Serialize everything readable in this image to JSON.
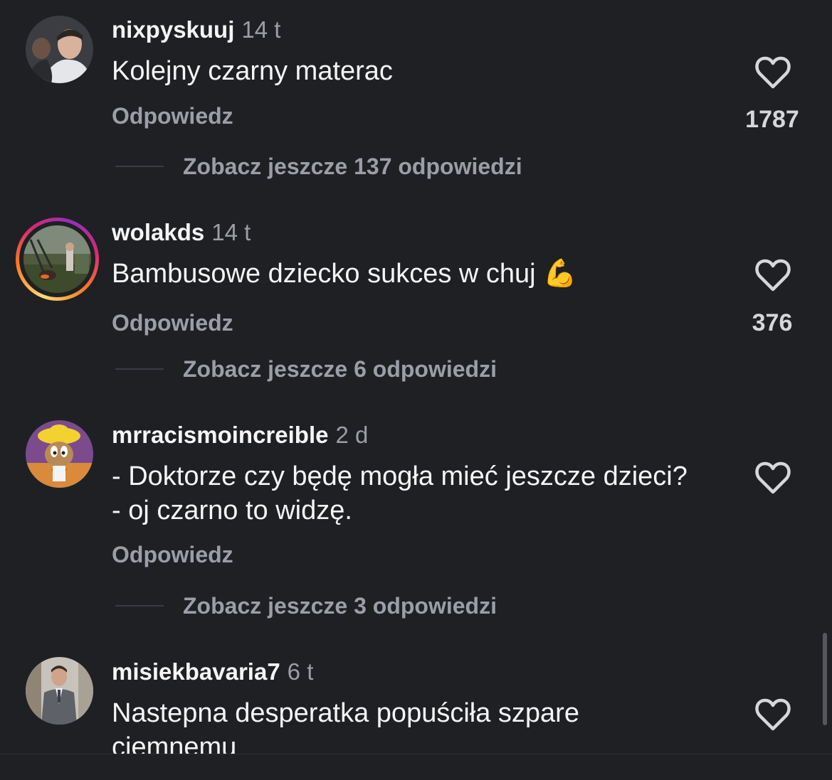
{
  "comments": [
    {
      "username": "nixpyskuuj",
      "time": "14 t",
      "text": "Kolejny czarny materac",
      "reply_label": "Odpowiedz",
      "likes": "1787",
      "more_replies": "Zobacz jeszcze 137 odpowiedzi"
    },
    {
      "username": "wolakds",
      "time": "14 t",
      "text": "Bambusowe dziecko sukces w chuj",
      "emoji": "💪",
      "reply_label": "Odpowiedz",
      "likes": "376",
      "more_replies": "Zobacz jeszcze 6 odpowiedzi"
    },
    {
      "username": "mrracismoincreible",
      "time": "2 d",
      "text": "- Doktorze czy będę mogła mieć jeszcze dzieci? - oj czarno to widzę.",
      "reply_label": "Odpowiedz",
      "more_replies": "Zobacz jeszcze 3 odpowiedzi"
    },
    {
      "username": "misiekbavaria7",
      "time": "6 t",
      "text": "Nastepna desperatka popuściła szpare ciemnemu"
    }
  ],
  "icons": {
    "like": "heart-outline-icon"
  },
  "colors": {
    "background": "#1f2024",
    "primary_text": "#f5f5f5",
    "secondary_text": "#9b9ea6"
  }
}
